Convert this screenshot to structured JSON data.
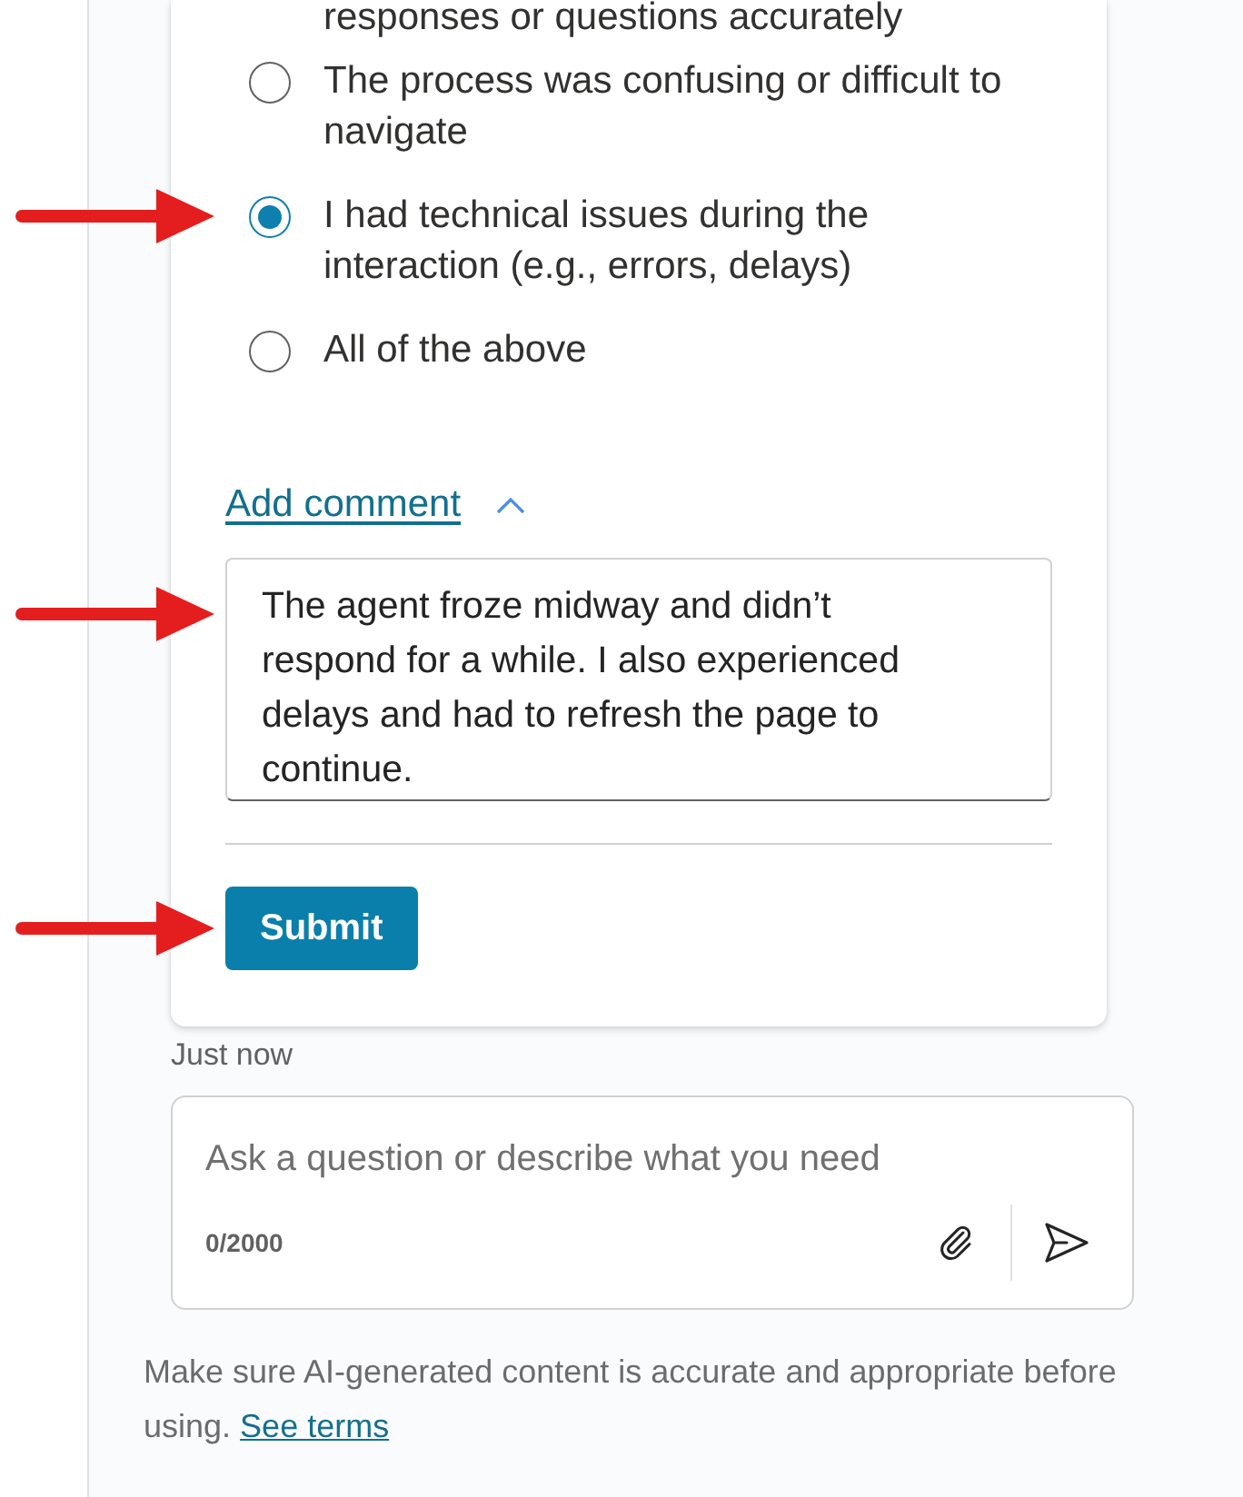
{
  "feedback": {
    "partial_option_text": "responses or questions accurately",
    "options": [
      {
        "label": "The process was confusing or difficult to navigate",
        "selected": false,
        "arrow": false
      },
      {
        "label": "I had technical issues during the interaction (e.g., errors, delays)",
        "selected": true,
        "arrow": true
      },
      {
        "label": "All of the above",
        "selected": false,
        "arrow": false
      }
    ],
    "comment": {
      "link": "Add comment",
      "expanded": true,
      "value": "The agent froze midway and didn’t respond for a while. I also experienced delays and had to refresh the page to continue.",
      "arrow": true
    },
    "submit": {
      "label": "Submit",
      "arrow": true
    }
  },
  "timestamp": "Just now",
  "composer": {
    "placeholder": "Ask a question or describe what you need",
    "counter": "0/2000"
  },
  "disclaimer": {
    "text": "Make sure AI-generated content is accurate and appropriate before using.",
    "link": "See terms"
  }
}
